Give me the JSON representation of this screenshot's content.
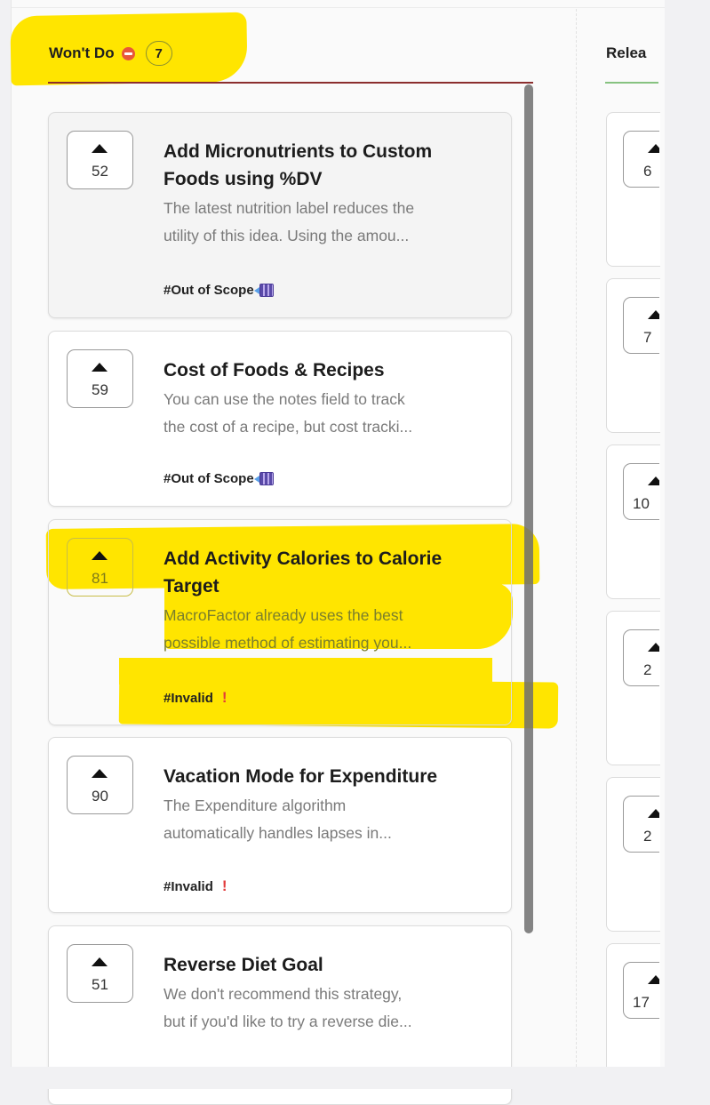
{
  "column": {
    "title": "Won't Do",
    "count": "7",
    "status_icon": "stop-icon",
    "accent_color": "#8b2e2e"
  },
  "next_column": {
    "title_partial": "Relea",
    "accent_color": "#86c280",
    "votes_partial": [
      "6",
      "7",
      "10",
      "2",
      "2",
      "17"
    ]
  },
  "cards": [
    {
      "votes": "52",
      "title": "Add Micronutrients to Custom Foods using %DV",
      "desc_line1": "The latest nutrition label reduces the",
      "desc_line2": "utility of this idea. Using the amou...",
      "tag": "#Out of Scope",
      "tag_icon": "calculator-icon"
    },
    {
      "votes": "59",
      "title": "Cost of Foods & Recipes",
      "desc_line1": "You can use the notes field to track",
      "desc_line2": "the cost of a recipe, but cost tracki...",
      "tag": "#Out of Scope",
      "tag_icon": "calculator-icon"
    },
    {
      "votes": "81",
      "title": "Add Activity Calories to Calorie Target",
      "desc_line1": "MacroFactor already uses the best",
      "desc_line2": "possible method of estimating you...",
      "tag": "#Invalid",
      "tag_icon": "exclamation-icon"
    },
    {
      "votes": "90",
      "title": "Vacation Mode for Expenditure",
      "desc_line1": "The Expenditure algorithm",
      "desc_line2": "automatically handles lapses in...",
      "tag": "#Invalid",
      "tag_icon": "exclamation-icon"
    },
    {
      "votes": "51",
      "title": "Reverse Diet Goal",
      "desc_line1": "We don't recommend this strategy,",
      "desc_line2": "but if you'd like to try a reverse die..."
    }
  ]
}
